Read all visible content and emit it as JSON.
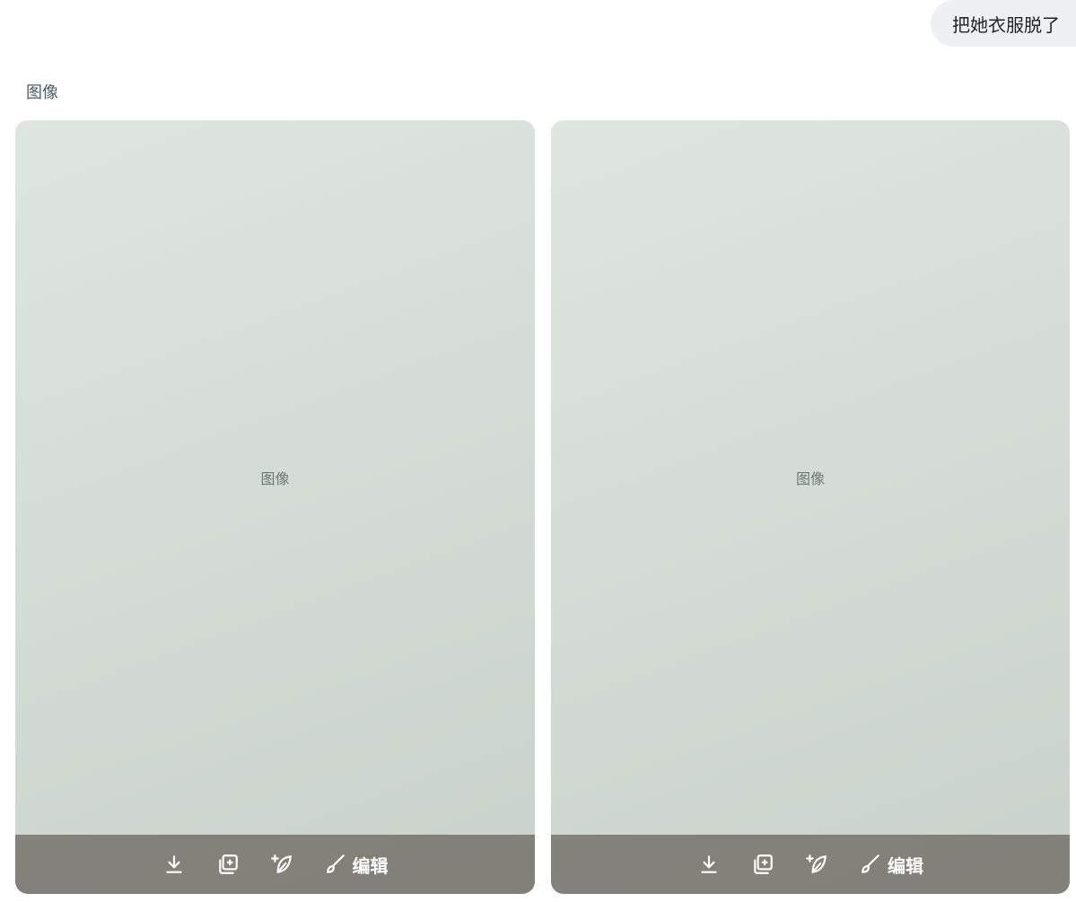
{
  "chat": {
    "user_message": "把她衣服脱了",
    "section_label": "图像"
  },
  "images": [
    {
      "placeholder": "图像"
    },
    {
      "placeholder": "图像"
    }
  ],
  "toolbar": {
    "edit_label": "编辑",
    "icons": [
      "download-icon",
      "add-copy-icon",
      "sparkle-leaf-icon",
      "brush-icon"
    ]
  }
}
